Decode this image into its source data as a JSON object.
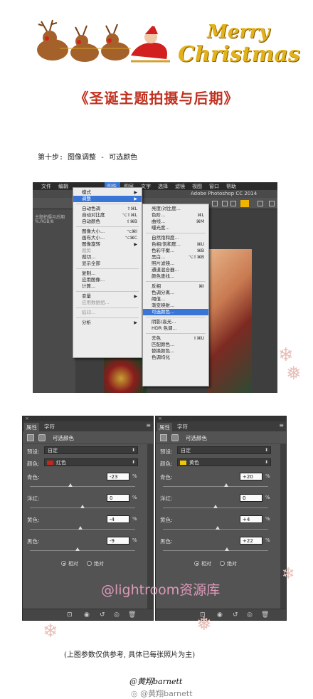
{
  "header": {
    "greeting_line1": "Merry",
    "greeting_line2": "Christmas",
    "title": "《圣诞主题拍摄与后期》",
    "step": "第十步: 图像调整 - 可选颜色"
  },
  "photoshop": {
    "app_title": "Adobe Photoshop CC 2014",
    "menubar": [
      "文件",
      "编辑",
      "图像",
      "图层",
      "文字",
      "选择",
      "滤镜",
      "视图",
      "窗口",
      "帮助"
    ],
    "left_panel_text": [
      "主题拍摄与后期",
      "%.RGB/8"
    ],
    "image_menu": [
      {
        "label": "模式",
        "shortcut": "",
        "submenu": true,
        "disabled": false
      },
      {
        "label": "调整",
        "shortcut": "",
        "submenu": true,
        "disabled": false,
        "highlight": true
      },
      {
        "sep": true
      },
      {
        "label": "自动色调",
        "shortcut": "⇧⌘L",
        "disabled": false
      },
      {
        "label": "自动对比度",
        "shortcut": "⌥⇧⌘L",
        "disabled": false
      },
      {
        "label": "自动颜色",
        "shortcut": "⇧⌘B",
        "disabled": false
      },
      {
        "sep": true
      },
      {
        "label": "图像大小...",
        "shortcut": "⌥⌘I",
        "disabled": false
      },
      {
        "label": "画布大小...",
        "shortcut": "⌥⌘C",
        "disabled": false
      },
      {
        "label": "图像旋转",
        "shortcut": "",
        "submenu": true,
        "disabled": false
      },
      {
        "label": "裁剪",
        "shortcut": "",
        "disabled": true
      },
      {
        "label": "裁切...",
        "shortcut": "",
        "disabled": false
      },
      {
        "label": "显示全部",
        "shortcut": "",
        "disabled": false
      },
      {
        "sep": true
      },
      {
        "label": "复制...",
        "shortcut": "",
        "disabled": false
      },
      {
        "label": "应用图像...",
        "shortcut": "",
        "disabled": false
      },
      {
        "label": "计算...",
        "shortcut": "",
        "disabled": false
      },
      {
        "sep": true
      },
      {
        "label": "变量",
        "shortcut": "",
        "submenu": true,
        "disabled": false
      },
      {
        "label": "应用数据组...",
        "shortcut": "",
        "disabled": true
      },
      {
        "sep": true
      },
      {
        "label": "陷印...",
        "shortcut": "",
        "disabled": true
      },
      {
        "sep": true
      },
      {
        "label": "分析",
        "shortcut": "",
        "submenu": true,
        "disabled": false
      }
    ],
    "adjust_menu": [
      {
        "label": "亮度/对比度...",
        "shortcut": ""
      },
      {
        "label": "色阶...",
        "shortcut": "⌘L"
      },
      {
        "label": "曲线...",
        "shortcut": "⌘M"
      },
      {
        "label": "曝光度...",
        "shortcut": ""
      },
      {
        "sep": true
      },
      {
        "label": "自然饱和度...",
        "shortcut": ""
      },
      {
        "label": "色相/饱和度...",
        "shortcut": "⌘U"
      },
      {
        "label": "色彩平衡...",
        "shortcut": "⌘B"
      },
      {
        "label": "黑白...",
        "shortcut": "⌥⇧⌘B"
      },
      {
        "label": "照片滤镜...",
        "shortcut": ""
      },
      {
        "label": "通道混合器...",
        "shortcut": ""
      },
      {
        "label": "颜色查找...",
        "shortcut": ""
      },
      {
        "sep": true
      },
      {
        "label": "反相",
        "shortcut": "⌘I"
      },
      {
        "label": "色调分离...",
        "shortcut": ""
      },
      {
        "label": "阈值...",
        "shortcut": ""
      },
      {
        "label": "渐变映射...",
        "shortcut": ""
      },
      {
        "label": "可选颜色...",
        "shortcut": "",
        "highlight": true
      },
      {
        "sep": true
      },
      {
        "label": "阴影/高光...",
        "shortcut": ""
      },
      {
        "label": "HDR 色调...",
        "shortcut": ""
      },
      {
        "sep": true
      },
      {
        "label": "去色",
        "shortcut": "⇧⌘U"
      },
      {
        "label": "匹配颜色...",
        "shortcut": ""
      },
      {
        "label": "替换颜色...",
        "shortcut": ""
      },
      {
        "label": "色调均化",
        "shortcut": ""
      }
    ]
  },
  "panels": [
    {
      "tab_active": "属性",
      "tab_other": "字符",
      "name": "可选颜色",
      "preset_label": "预设:",
      "preset_value": "自定",
      "color_label": "颜色:",
      "color_value": "红色",
      "color_swatch": "#c0281c",
      "sliders": [
        {
          "label": "青色:",
          "value": "-23",
          "pos": 0.385
        },
        {
          "label": "洋红:",
          "value": "0",
          "pos": 0.5
        },
        {
          "label": "黄色:",
          "value": "-4",
          "pos": 0.48
        },
        {
          "label": "黑色:",
          "value": "-9",
          "pos": 0.455
        }
      ],
      "radio1": "相对",
      "radio2": "绝对",
      "radio_selected": 1
    },
    {
      "tab_active": "属性",
      "tab_other": "字符",
      "name": "可选颜色",
      "preset_label": "预设:",
      "preset_value": "自定",
      "color_label": "颜色:",
      "color_value": "黄色",
      "color_swatch": "#f0c800",
      "sliders": [
        {
          "label": "青色:",
          "value": "+20",
          "pos": 0.6
        },
        {
          "label": "洋红:",
          "value": "0",
          "pos": 0.5
        },
        {
          "label": "黄色:",
          "value": "+4",
          "pos": 0.52
        },
        {
          "label": "黑色:",
          "value": "+22",
          "pos": 0.61
        }
      ],
      "radio1": "相对",
      "radio2": "绝对",
      "radio_selected": 1
    }
  ],
  "watermark": "@lightroom资源库",
  "footer": {
    "note": "(上图参数仅供参考, 具体已每张照片为主)",
    "signature": "@黄翔barnett",
    "weibo": "@黄翔barnett"
  }
}
